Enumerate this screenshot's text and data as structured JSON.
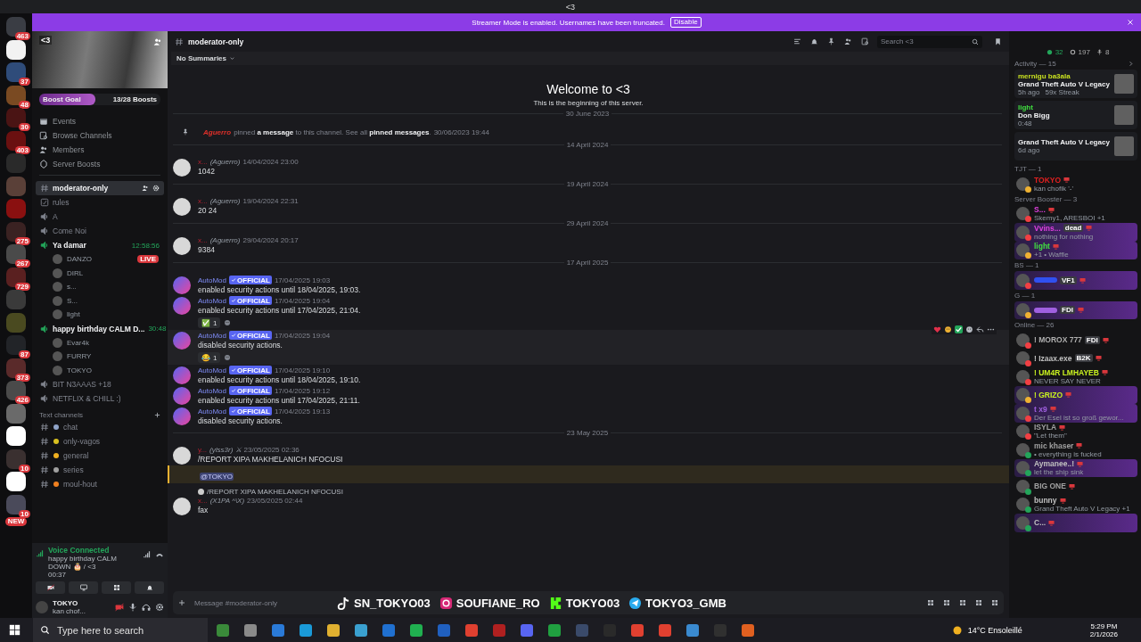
{
  "window": {
    "title": "<3"
  },
  "servers": [
    {
      "badge": "463",
      "color": "#3a3d44"
    },
    {
      "color": "#f2f2f2"
    },
    {
      "badge": "37",
      "color": "#2f4c7a"
    },
    {
      "badge": "48",
      "color": "#7a4a22"
    },
    {
      "badge": "30",
      "color": "#4a1414"
    },
    {
      "badge": "403",
      "color": "#6a1010"
    },
    {
      "color": "#2a2a2a"
    },
    {
      "color": "#5a4038"
    },
    {
      "color": "#8a1010"
    },
    {
      "badge": "275",
      "color": "#3a2222"
    },
    {
      "badge": "267",
      "color": "#4a4a4a"
    },
    {
      "badge": "729",
      "color": "#5a2020"
    },
    {
      "color": "#3a3a3a"
    },
    {
      "color": "#4a4a20"
    },
    {
      "badge": "87",
      "color": "#222428"
    },
    {
      "badge": "373",
      "color": "#5a2a2a"
    },
    {
      "badge": "426",
      "color": "#4a4a4a"
    },
    {
      "color": "#6a6a6a"
    },
    {
      "color": "#ffffff"
    },
    {
      "badge": "10",
      "color": "#3a3030"
    },
    {
      "color": "#ffffff"
    },
    {
      "badge": "10",
      "color": "#4a4a5a"
    }
  ],
  "new_badge": "NEW",
  "banner": {
    "text": "Streamer Mode is enabled. Usernames have been truncated.",
    "button": "Disable"
  },
  "server": {
    "name": "<3",
    "boost_label": "Boost Goal",
    "boost_count": "13/28 Boosts",
    "level": 0.46
  },
  "nav": [
    "Events",
    "Browse Channels",
    "Members",
    "Server Boosts"
  ],
  "channels": [
    {
      "kind": "text",
      "name": "moderator-only",
      "selected": true,
      "active": false
    },
    {
      "kind": "rules",
      "name": "rules",
      "selected": false,
      "active": false
    },
    {
      "kind": "voice",
      "name": "A",
      "selected": false,
      "active": false
    },
    {
      "kind": "voice",
      "name": "Come Noi",
      "selected": false,
      "active": false
    },
    {
      "kind": "voice",
      "name": "Ya damar",
      "selected": false,
      "active": true,
      "timer": "12:58:56",
      "children": [
        {
          "name": "DANZO",
          "badge": "LIVE"
        },
        {
          "name": "DIRL"
        },
        {
          "name": "s..."
        },
        {
          "name": "S..."
        },
        {
          "name": "light"
        }
      ]
    },
    {
      "kind": "voice",
      "name": "happy birthday CALM D...",
      "selected": false,
      "active": true,
      "timer": "30:48",
      "children": [
        {
          "name": "Evar4k"
        },
        {
          "name": "FURRY"
        },
        {
          "name": "TOKYO"
        }
      ]
    },
    {
      "kind": "voice",
      "name": "BIT N3AAAS +18",
      "selected": false,
      "active": false
    },
    {
      "kind": "voice",
      "name": "NETFLIX & CHILL :)",
      "selected": false,
      "active": false
    }
  ],
  "category": {
    "name": "Text channels",
    "channels": [
      {
        "name": "chat",
        "color": "#8fa3c8"
      },
      {
        "name": "only-vagos",
        "color": "#d8c020"
      },
      {
        "name": "general",
        "color": "#f0b020"
      },
      {
        "name": "series",
        "color": "#a0a0a0"
      },
      {
        "name": "moul-hout",
        "color": "#f08020"
      }
    ]
  },
  "voice": {
    "status": "Voice Connected",
    "channel": "happy birthday CALM DOWN 🎂 / <3",
    "elapsed": "00:37"
  },
  "user": {
    "name": "TOKYO",
    "status": "kan chof..."
  },
  "chat": {
    "channel": "moderator-only",
    "summaries": "No Summaries",
    "search": {
      "placeholder": "Search <3"
    },
    "welcome_title": "Welcome to <3",
    "welcome_sub": "This is the beginning of this server.",
    "composer": {
      "placeholder": "Message #moderator-only"
    }
  },
  "messages": [
    {
      "kind": "divider",
      "text": "30 June 2023"
    },
    {
      "kind": "system",
      "author": "Aguerro",
      "text": "pinned **a message** to this channel. See all **pinned messages**.",
      "time": "30/06/2023 19:44"
    },
    {
      "kind": "divider",
      "text": "14 April 2024"
    },
    {
      "kind": "message",
      "name": "x...",
      "nick": "(Aguerro)",
      "time": "14/04/2024 23:00",
      "text": "1042"
    },
    {
      "kind": "divider",
      "text": "19 April 2024"
    },
    {
      "kind": "message",
      "name": "x...",
      "nick": "(Aguerro)",
      "time": "19/04/2024 22:31",
      "text": "20 24"
    },
    {
      "kind": "divider",
      "text": "29 April 2024"
    },
    {
      "kind": "message",
      "name": "x...",
      "nick": "(Aguerro)",
      "time": "29/04/2024 20:17",
      "text": "9384"
    },
    {
      "kind": "divider",
      "text": "17 April 2025"
    },
    {
      "kind": "automod",
      "name": "AutoMod",
      "tag": "OFFICIAL",
      "time": "17/04/2025 19:03",
      "text": "enabled security actions until 18/04/2025, 19:03.",
      "hovered": false
    },
    {
      "kind": "automod",
      "name": "AutoMod",
      "tag": "OFFICIAL",
      "time": "17/04/2025 19:04",
      "text": "enabled security actions until 17/04/2025, 21:04.",
      "hovered": false,
      "reactions": [
        {
          "emoji": "✅",
          "count": "1"
        }
      ]
    },
    {
      "kind": "automod",
      "name": "AutoMod",
      "tag": "OFFICIAL",
      "time": "17/04/2025 19:04",
      "text": "disabled security actions.",
      "hovered": true,
      "reactions": [
        {
          "emoji": "😂",
          "count": "1"
        }
      ]
    },
    {
      "kind": "automod",
      "name": "AutoMod",
      "tag": "OFFICIAL",
      "time": "17/04/2025 19:10",
      "text": "enabled security actions until 18/04/2025, 19:10.",
      "hovered": false
    },
    {
      "kind": "automod",
      "name": "AutoMod",
      "tag": "OFFICIAL",
      "time": "17/04/2025 19:12",
      "text": "enabled security actions until 17/04/2025, 21:11.",
      "hovered": false
    },
    {
      "kind": "automod",
      "name": "AutoMod",
      "tag": "OFFICIAL",
      "time": "17/04/2025 19:13",
      "text": "disabled security actions.",
      "hovered": false
    },
    {
      "kind": "divider",
      "text": "23 May 2025"
    },
    {
      "kind": "message",
      "name": "y...",
      "nick": "(ylss3r) ⚔",
      "time": "23/05/2025 02:36",
      "text": "/REPORT XIPA MAKHELANICH NFOCUSI",
      "mention": "@TOKYO"
    },
    {
      "kind": "message",
      "name": "x...",
      "nick": "(X1PA ^\\X)",
      "time": "23/05/2025 02:44",
      "text": "fax",
      "reply": "/REPORT XIPA MAKHELANICH NFOCUSI"
    }
  ],
  "overlay": [
    {
      "kind": "tiktok",
      "text": "SN_TOKYO03"
    },
    {
      "kind": "instagram",
      "text": "SOUFIANE_RO"
    },
    {
      "kind": "kick",
      "text": "TOKYO03"
    },
    {
      "kind": "telegram",
      "text": "TOKYO3_GMB"
    }
  ],
  "members": {
    "counts": [
      {
        "kind": "online",
        "text": "32"
      },
      {
        "kind": "offline",
        "text": "197"
      },
      {
        "kind": "voice",
        "text": "8"
      }
    ],
    "activity_title": "Activity — 15",
    "activity": [
      {
        "user": "mernigu ba3ala",
        "color": "#c8e020",
        "title": "Grand Theft Auto V Legacy",
        "meta": "5h ago",
        "extra": "59x Streak"
      },
      {
        "user": "light",
        "color": "#40e040",
        "title": "Don Bigg",
        "meta": "0:48"
      },
      {
        "title": "Grand Theft Auto V Legacy",
        "meta": "6d ago"
      }
    ],
    "groups": [
      {
        "title": "TJT — 1",
        "items": [
          {
            "name": "TOKYO",
            "color": "#e02020",
            "presence": {
              "color": "#f0b232"
            },
            "activity": "kan chofik '-'",
            "boosted": false
          }
        ]
      },
      {
        "title": "Server Booster — 3",
        "items": [
          {
            "name": "S...",
            "color": "#e040e0",
            "presence": {
              "color": "#f23f43"
            },
            "activity": "Skemy1, ARESBOI +1",
            "boosted": false
          },
          {
            "name": "Vvins...",
            "color": "#e040e0",
            "presence": {
              "color": "#f23f43"
            },
            "tag": "dead",
            "activity": "nothing for nothing",
            "boosted": true
          },
          {
            "name": "light",
            "color": "#40e040",
            "presence": {
              "color": "#f0b232"
            },
            "activity": "+1 • Waffle",
            "boosted": true
          }
        ]
      },
      {
        "title": "BS — 1",
        "items": [
          {
            "color": "#3050f0",
            "presence": {
              "color": "#f23f43"
            },
            "tag": "VF1",
            "boosted": true
          }
        ]
      },
      {
        "title": "G — 1",
        "items": [
          {
            "color": "#a060e0",
            "presence": {
              "color": "#f0b232"
            },
            "tag": "FDI",
            "boosted": true
          }
        ]
      },
      {
        "title": "Online — 26",
        "items": [
          {
            "name": "! MOROX 777",
            "color": "#b0b0b0",
            "presence": {
              "color": "#f23f43"
            },
            "tag": "FDI",
            "boosted": false
          },
          {
            "name": "! Izaax.exe",
            "color": "#c0c0c0",
            "presence": {
              "color": "#f23f43"
            },
            "tag": "B2K",
            "boosted": false
          },
          {
            "name": "! UM4R LMHAYEB",
            "color": "#c8f020",
            "presence": {
              "color": "#f23f43"
            },
            "activity": "NEVER SAY NEVER",
            "boosted": false
          },
          {
            "name": "! GRIZO",
            "color": "#c8f020",
            "presence": {
              "color": "#f0b232"
            },
            "boosted": true
          },
          {
            "name": "t x9",
            "color": "#a060e0",
            "presence": {
              "color": "#f23f43"
            },
            "activity": "Der Esel ist so groß gewor...",
            "boosted": true
          },
          {
            "name": "ISYLA",
            "color": "#a0a0a0",
            "presence": {
              "color": "#f23f43"
            },
            "activity": "\"Let them\"",
            "boosted": false
          },
          {
            "name": "mic khaser",
            "color": "#a0a0a0",
            "presence": {
              "color": "#23a55a"
            },
            "activity": "• everything is fucked",
            "boosted": false
          },
          {
            "name": "Aymanee..!",
            "color": "#c0c0c0",
            "presence": {
              "color": "#23a55a"
            },
            "activity": "let the ship sink",
            "boosted": true
          },
          {
            "name": "BIG ONE",
            "color": "#a0a0a0",
            "presence": {
              "color": "#23a55a"
            },
            "boosted": false
          },
          {
            "name": "bunny",
            "color": "#c0c0c0",
            "presence": {
              "color": "#23a55a"
            },
            "activity": "Grand Theft Auto V Legacy +1",
            "boosted": false
          },
          {
            "name": "C...",
            "color": "#c0c0c0",
            "presence": {
              "color": "#23a55a"
            },
            "boosted": true
          }
        ]
      }
    ]
  },
  "taskbar": {
    "search": {
      "placeholder": "Type here to search"
    },
    "apps": [
      {
        "color": "#3a8a3a"
      },
      {
        "color": "#8a8a8a"
      },
      {
        "color": "#2a7ad8"
      },
      {
        "color": "#1a9ad8"
      },
      {
        "color": "#e0b030"
      },
      {
        "color": "#3aa0d0"
      },
      {
        "color": "#2070d0"
      },
      {
        "color": "#20b050"
      },
      {
        "color": "#2060c0"
      },
      {
        "color": "#e04030"
      },
      {
        "color": "#b02020"
      },
      {
        "color": "#5865f2"
      },
      {
        "color": "#20a040"
      },
      {
        "color": "#3a4a6a"
      },
      {
        "color": "#2a2a2a"
      },
      {
        "color": "#e04030"
      },
      {
        "color": "#e04030"
      },
      {
        "color": "#3a8ad0"
      },
      {
        "color": "#303030"
      },
      {
        "color": "#e06020"
      }
    ],
    "weather": "14°C Ensoleillé",
    "time": "5:29 PM",
    "date": "2/1/2026"
  }
}
